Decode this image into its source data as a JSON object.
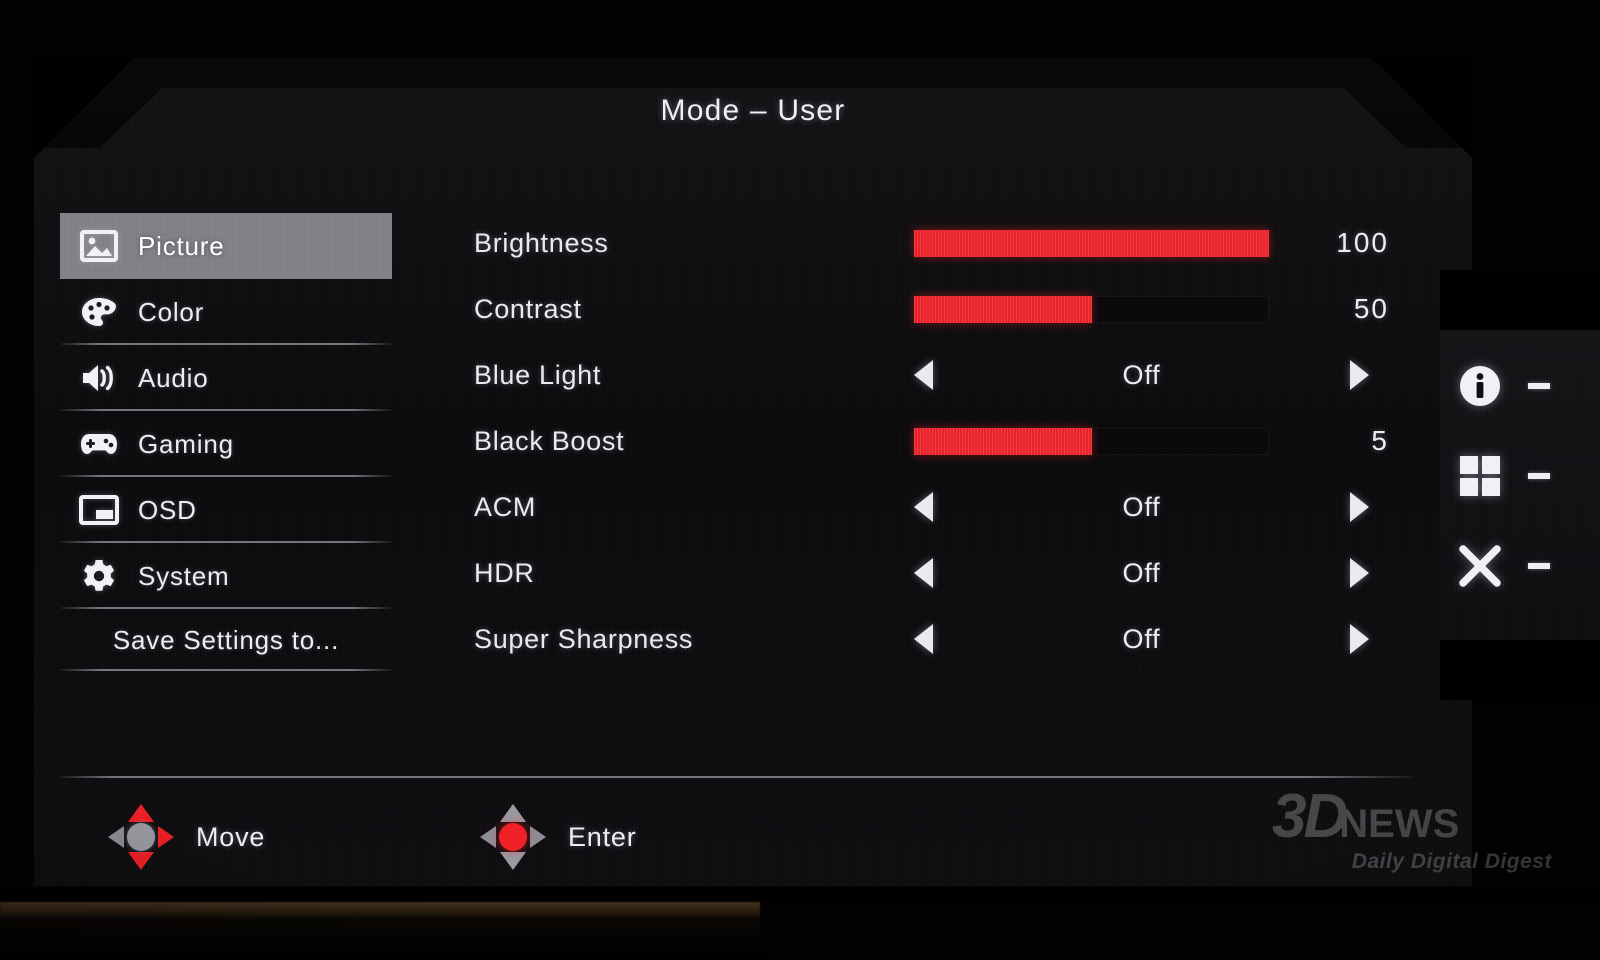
{
  "title": "Mode – User",
  "menu": {
    "items": [
      {
        "label": "Picture",
        "icon": "picture-icon",
        "selected": true
      },
      {
        "label": "Color",
        "icon": "palette-icon",
        "selected": false
      },
      {
        "label": "Audio",
        "icon": "speaker-icon",
        "selected": false
      },
      {
        "label": "Gaming",
        "icon": "gamepad-icon",
        "selected": false
      },
      {
        "label": "OSD",
        "icon": "osd-icon",
        "selected": false
      },
      {
        "label": "System",
        "icon": "gear-icon",
        "selected": false
      },
      {
        "label": "Save Settings to...",
        "icon": "",
        "selected": false
      }
    ]
  },
  "settings": {
    "rows": [
      {
        "label": "Brightness",
        "type": "slider",
        "value": "100",
        "percent": 100
      },
      {
        "label": "Contrast",
        "type": "slider",
        "value": "50",
        "percent": 50
      },
      {
        "label": "Blue Light",
        "type": "option",
        "value": "Off"
      },
      {
        "label": "Black Boost",
        "type": "slider",
        "value": "5",
        "percent": 50
      },
      {
        "label": "ACM",
        "type": "option",
        "value": "Off"
      },
      {
        "label": "HDR",
        "type": "option",
        "value": "Off"
      },
      {
        "label": "Super Sharpness",
        "type": "option",
        "value": "Off"
      }
    ]
  },
  "hints": {
    "move": "Move",
    "enter": "Enter"
  },
  "side_panel": {
    "rows": [
      {
        "icon": "info-icon",
        "value": "-"
      },
      {
        "icon": "grid-icon",
        "value": "-"
      },
      {
        "icon": "close-icon",
        "value": "-"
      }
    ]
  },
  "watermark": {
    "brand_3d": "3D",
    "brand_news": "NEWS",
    "tagline": "Daily Digital Digest"
  },
  "colors": {
    "accent_red": "#f5252e",
    "highlight_gray": "#7e8086",
    "text": "#ececf2",
    "panel_bg": "#0d0c0e"
  }
}
